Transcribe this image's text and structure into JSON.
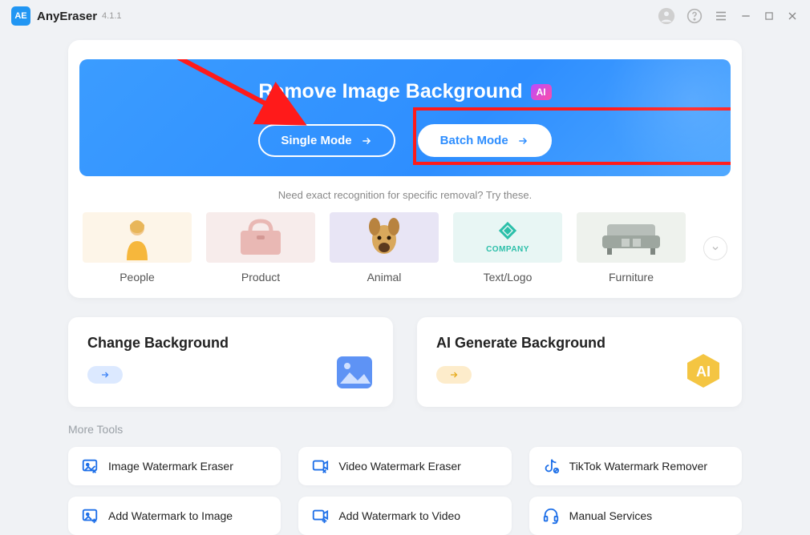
{
  "app": {
    "name": "AnyEraser",
    "version": "4.1.1"
  },
  "hero": {
    "title": "Remove Image Background",
    "aiBadge": "AI",
    "singleMode": "Single Mode",
    "batchMode": "Batch Mode",
    "hint": "Need exact recognition for specific removal? Try these."
  },
  "categories": [
    {
      "label": "People"
    },
    {
      "label": "Product"
    },
    {
      "label": "Animal"
    },
    {
      "label": "Text/Logo",
      "innerText": "COMPANY"
    },
    {
      "label": "Furniture"
    }
  ],
  "cards": {
    "change": "Change Background",
    "generate": "AI Generate Background"
  },
  "moreTools": {
    "label": "More Tools",
    "items": [
      "Image Watermark Eraser",
      "Video Watermark Eraser",
      "TikTok Watermark Remover",
      "Add Watermark to Image",
      "Add Watermark to Video",
      "Manual Services"
    ]
  }
}
